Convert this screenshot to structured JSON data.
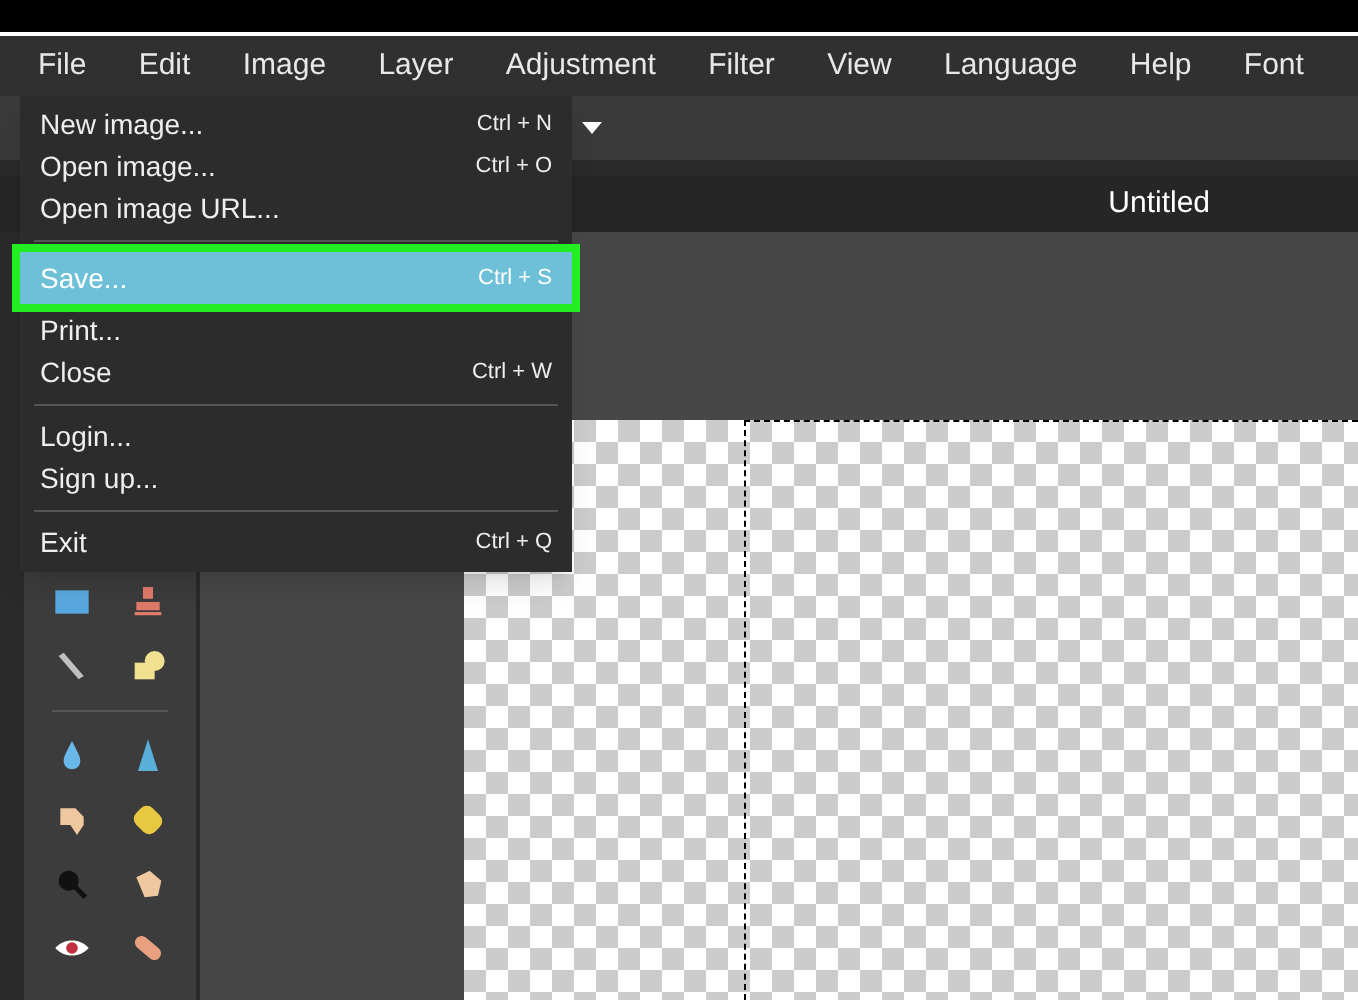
{
  "menubar": [
    {
      "label": "File"
    },
    {
      "label": "Edit"
    },
    {
      "label": "Image"
    },
    {
      "label": "Layer"
    },
    {
      "label": "Adjustment"
    },
    {
      "label": "Filter"
    },
    {
      "label": "View"
    },
    {
      "label": "Language"
    },
    {
      "label": "Help"
    },
    {
      "label": "Font"
    }
  ],
  "file_menu": [
    {
      "kind": "item",
      "label": "New image...",
      "shortcut": "Ctrl + N",
      "selected": false
    },
    {
      "kind": "item",
      "label": "Open image...",
      "shortcut": "Ctrl + O",
      "selected": false
    },
    {
      "kind": "item",
      "label": "Open image URL...",
      "selected": false
    },
    {
      "kind": "separator"
    },
    {
      "kind": "item",
      "label": "Save...",
      "shortcut": "Ctrl + S",
      "selected": true
    },
    {
      "kind": "item",
      "label": "Print...",
      "selected": false
    },
    {
      "kind": "item",
      "label": "Close",
      "shortcut": "Ctrl + W",
      "selected": false
    },
    {
      "kind": "separator"
    },
    {
      "kind": "item",
      "label": "Login...",
      "selected": false
    },
    {
      "kind": "item",
      "label": "Sign up...",
      "selected": false
    },
    {
      "kind": "separator"
    },
    {
      "kind": "item",
      "label": "Exit",
      "shortcut": "Ctrl + Q",
      "selected": false
    }
  ],
  "document_tab": {
    "title": "Untitled"
  }
}
